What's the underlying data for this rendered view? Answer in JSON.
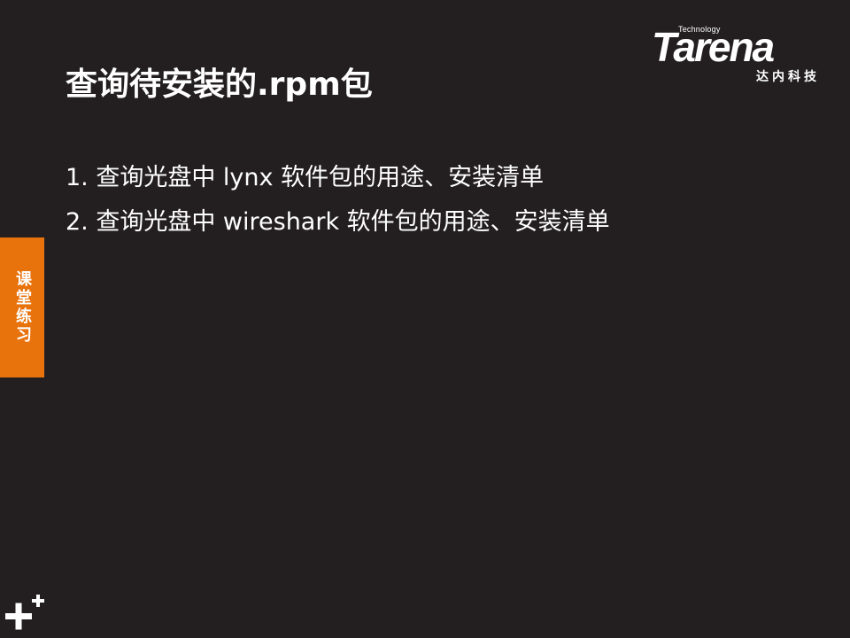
{
  "logo": {
    "technology": "Technology",
    "word": "Tarena",
    "chinese": "达内科技"
  },
  "slide": {
    "title": "查询待安装的.rpm包",
    "items": [
      "1. 查询光盘中 lynx 软件包的用途、安装清单",
      "2. 查询光盘中 wireshark 软件包的用途、安装清单"
    ],
    "side_tab_label": "课堂练习"
  },
  "colors": {
    "background": "#231f20",
    "accent": "#e8720c",
    "text": "#ffffff"
  },
  "icons": {
    "decoration": "plus-icon"
  }
}
